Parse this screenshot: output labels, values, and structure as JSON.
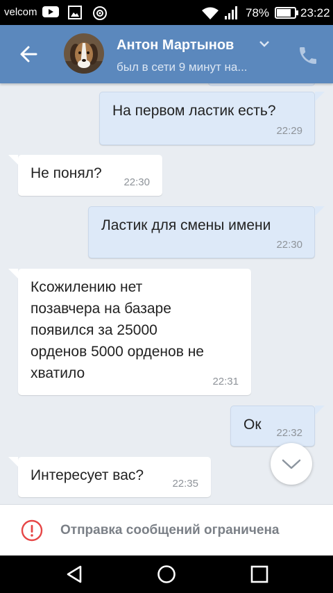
{
  "status_bar": {
    "carrier": "velcom",
    "battery": "78%",
    "time": "23:22",
    "icons": [
      "youtube-icon",
      "image-icon",
      "location-icon",
      "wifi-icon",
      "signal-icon",
      "battery-icon"
    ]
  },
  "header": {
    "name": "Антон Мартынов",
    "status": "был в сети 9 минут на..."
  },
  "messages": [
    {
      "dir": "out",
      "text": "На первом ластик есть?",
      "time": "22:29"
    },
    {
      "dir": "in",
      "text": "Не понял?",
      "time": "22:30"
    },
    {
      "dir": "out",
      "text": "Ластик для смены имени",
      "time": "22:30"
    },
    {
      "dir": "in",
      "text": "Ксожилению нет\nпозавчера на базаре\nпоявился за 25000\nорденов  5000 орденов  не\nхватило",
      "time": "22:31"
    },
    {
      "dir": "out",
      "text": "Ок",
      "time": "22:32"
    },
    {
      "dir": "in",
      "text": "Интересует вас?",
      "time": "22:35"
    }
  ],
  "footer": {
    "restricted_text": "Отправка сообщений ограничена"
  },
  "colors": {
    "appbar": "#5b88bd",
    "background": "#e9edf2",
    "outgoing_bubble": "#dde9f8",
    "incoming_bubble": "#ffffff",
    "warning": "#e64646"
  }
}
